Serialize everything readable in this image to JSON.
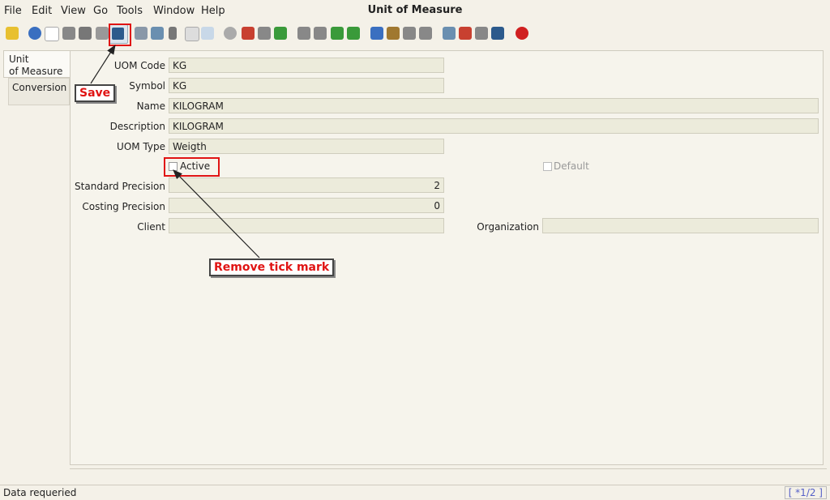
{
  "window": {
    "title": "Unit of Measure"
  },
  "menu": {
    "file": "File",
    "edit": "Edit",
    "view": "View",
    "go": "Go",
    "tools": "Tools",
    "window": "Window",
    "help": "Help"
  },
  "tabs": {
    "unit_of_measure": "Unit\nof Measure",
    "conversion": "Conversion"
  },
  "fields": {
    "uom_code": {
      "label": "UOM Code",
      "value": "KG"
    },
    "symbol": {
      "label": "Symbol",
      "value": "KG"
    },
    "name": {
      "label": "Name",
      "value": "KILOGRAM"
    },
    "description": {
      "label": "Description",
      "value": "KILOGRAM"
    },
    "uom_type": {
      "label": "UOM Type",
      "value": "Weigth"
    },
    "active": {
      "label": "Active",
      "checked": false
    },
    "default": {
      "label": "Default",
      "checked": false
    },
    "standard_precision": {
      "label": "Standard Precision",
      "value": "2"
    },
    "costing_precision": {
      "label": "Costing Precision",
      "value": "0"
    },
    "client": {
      "label": "Client",
      "value": ""
    },
    "organization": {
      "label": "Organization",
      "value": ""
    }
  },
  "annotations": {
    "save": "Save",
    "remove_tick": "Remove tick mark"
  },
  "status": {
    "message": "Data requeried",
    "record": "[ *1/2 ]"
  },
  "colors": {
    "accent_red": "#e01414",
    "field_bg": "#ecebdb"
  }
}
